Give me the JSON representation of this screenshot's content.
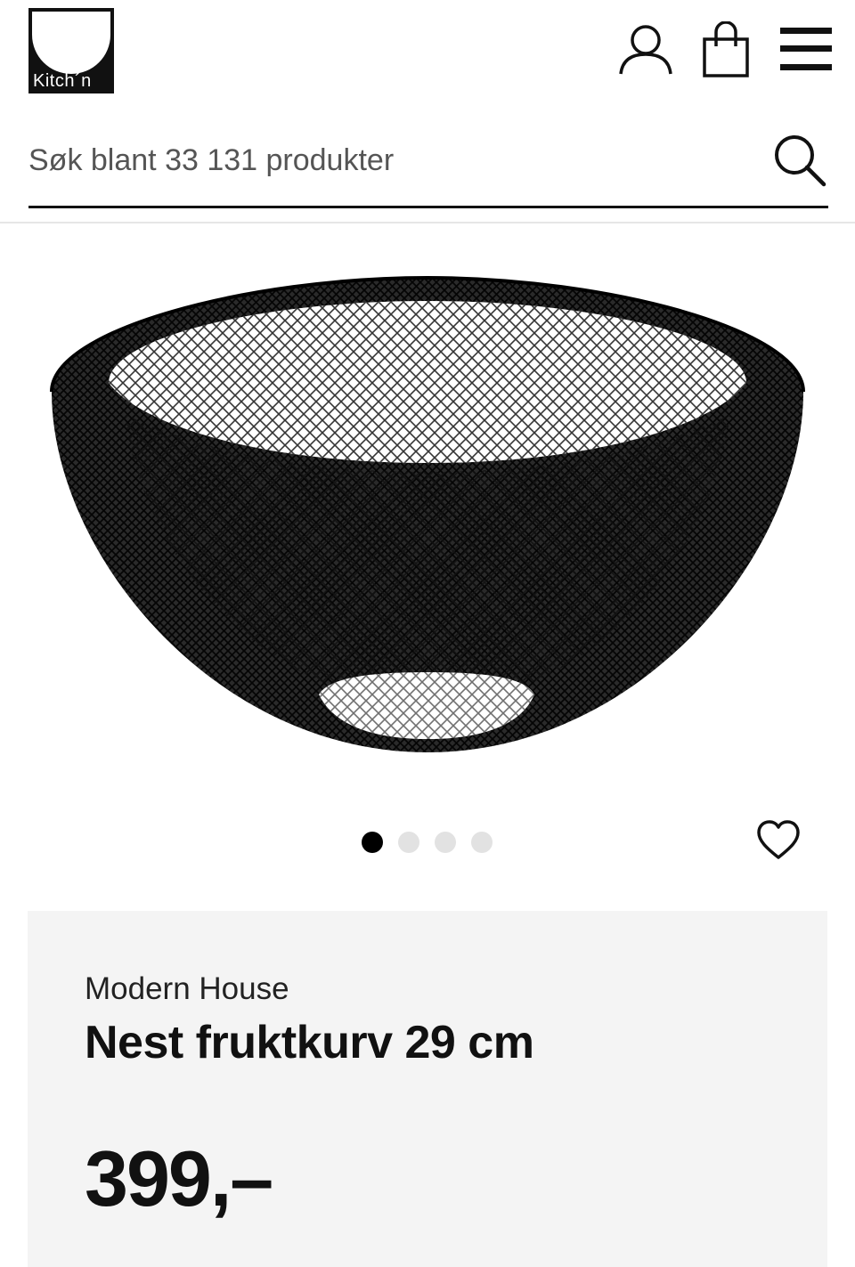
{
  "header": {
    "logo_text": "Kitch´n",
    "icons": [
      "account-icon",
      "shopping-bag-icon",
      "menu-icon"
    ]
  },
  "search": {
    "placeholder": "Søk blant 33 131 produkter",
    "icon": "search-icon"
  },
  "gallery": {
    "image_count": 4,
    "active_index": 0,
    "wishlist_icon": "heart-icon"
  },
  "product": {
    "brand": "Modern House",
    "title": "Nest fruktkurv 29 cm",
    "price": "399,–"
  },
  "colors": {
    "text": "#111111",
    "panel_bg": "#f4f4f4",
    "dot_active": "#000000",
    "dot_inactive": "#e2e2e2"
  }
}
